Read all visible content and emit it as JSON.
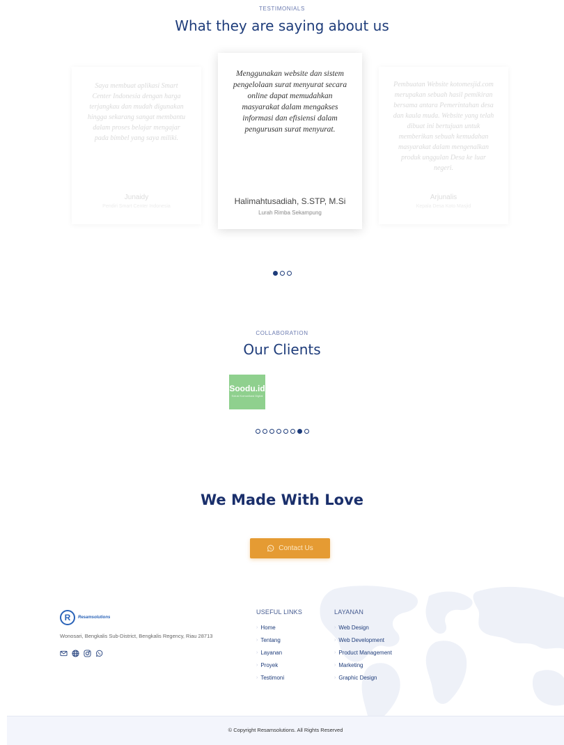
{
  "testimonials": {
    "eyebrow": "TESTIMONIALS",
    "title": "What they are saying about us",
    "items": [
      {
        "quote": "Saya membuat aplikasi Smart Center Indonesia dengan harga terjangkau dan mudah digunakan hingga sekarang sangat membantu dalam proses belajar mengajar pada bimbel yang saya miliki.",
        "name": "Junaidy",
        "role": "Pendiri Smart Center Indonesia"
      },
      {
        "quote": "Menggunakan website dan sistem pengelolaan surat menyurat secara online dapat memudahkan masyarakat dalam mengakses informasi dan efisiensi dalam pengurusan surat menyurat.",
        "name": "Halimahtusadiah, S.STP, M.Si",
        "role": "Lurah Rimba Sekampung"
      },
      {
        "quote": "Pembuatan Website kotomesjid.com merupakan sebuah hasil pemikiran bersama antara Pemerintahan desa dan kaula muda. Website yang telah dibuat ini bertujuan untuk memberikan sebuah kemudahan masyarakat dalam mengenalkan produk unggulan Desa ke luar negeri.",
        "name": "Arjunalis",
        "role": "Kepala Desa Koto Masjid"
      }
    ],
    "pagination": {
      "count": 3,
      "active_index": 0
    }
  },
  "clients": {
    "eyebrow": "COLLABORATION",
    "title": "Our Clients",
    "logo_text": "Soodu.id",
    "logo_sub": "Solusi Komunikasi Digital",
    "logo_color": "#8fd08e",
    "pagination": {
      "count": 8,
      "active_index": 6
    }
  },
  "cta": {
    "heading": "We Made With Love",
    "button_label": "Contact Us",
    "button_icon": "whatsapp-icon",
    "button_color": "#e59b33"
  },
  "footer": {
    "brand": "Resamsolutions",
    "address": "Wonosari, Bengkalis Sub-District, Bengkalis Regency, Riau 28713",
    "social_icons": [
      "email-icon",
      "globe-icon",
      "instagram-icon",
      "whatsapp-icon"
    ],
    "useful_links": {
      "title": "USEFUL LINKS",
      "items": [
        "Home",
        "Tentang",
        "Layanan",
        "Proyek",
        "Testimoni"
      ]
    },
    "services": {
      "title": "LAYANAN",
      "items": [
        "Web Design",
        "Web Development",
        "Product Management",
        "Marketing",
        "Graphic Design"
      ]
    },
    "copyright": "© Copyright Resamsolutions. All Rights Reserved"
  },
  "colors": {
    "primary": "#1e3c7a",
    "accent": "#e59b33",
    "footer_bottom_bg": "#f3f5fc"
  }
}
